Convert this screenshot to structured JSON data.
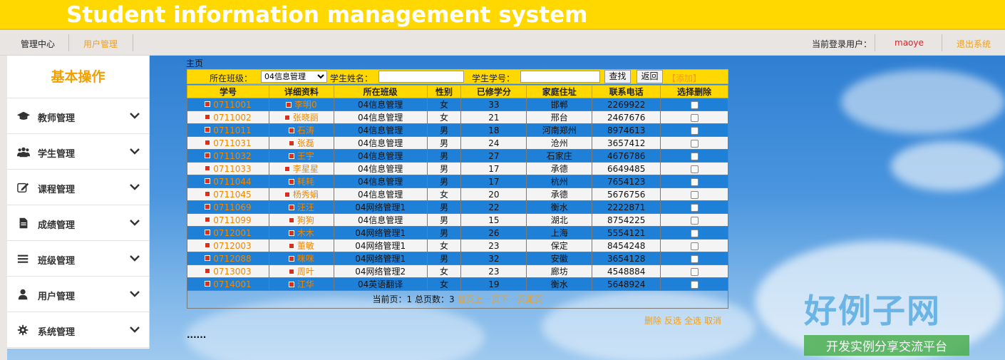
{
  "header": {
    "title": "Student information management system"
  },
  "nav": {
    "home": "管理中心",
    "user_mgmt": "用户管理",
    "current_user_label": "当前登录用户：",
    "current_user": "maoye",
    "logout": "退出系统"
  },
  "sidebar": {
    "title": "基本操作",
    "items": [
      {
        "label": "教师管理",
        "icon": "graduation-cap-icon"
      },
      {
        "label": "学生管理",
        "icon": "users-icon"
      },
      {
        "label": "课程管理",
        "icon": "edit-icon"
      },
      {
        "label": "成绩管理",
        "icon": "document-icon"
      },
      {
        "label": "班级管理",
        "icon": "list-icon"
      },
      {
        "label": "用户管理",
        "icon": "user-icon"
      },
      {
        "label": "系统管理",
        "icon": "gear-icon"
      }
    ]
  },
  "main": {
    "breadcrumb": "主页",
    "search": {
      "class_label": "所在班级：",
      "class_value": "04信息管理",
      "name_label": "学生姓名：",
      "name_value": "",
      "id_label": "学生学号：",
      "id_value": "",
      "find_button": "查找",
      "back_button": "返回",
      "add_link": "【添加】"
    },
    "table": {
      "headers": [
        "学号",
        "详细资料",
        "所在班级",
        "性别",
        "已修学分",
        "家庭住址",
        "联系电话",
        "选择删除"
      ],
      "rows": [
        {
          "id": "0711001",
          "name": "李明0",
          "class": "04信息管理",
          "gender": "女",
          "credits": "33",
          "address": "邯郸",
          "phone": "2269922"
        },
        {
          "id": "0711002",
          "name": "张晓丽",
          "class": "04信息管理",
          "gender": "女",
          "credits": "21",
          "address": "邢台",
          "phone": "2467676"
        },
        {
          "id": "0711011",
          "name": "石涛",
          "class": "04信息管理",
          "gender": "男",
          "credits": "18",
          "address": "河南郑州",
          "phone": "8974613"
        },
        {
          "id": "0711031",
          "name": "张磊",
          "class": "04信息管理",
          "gender": "男",
          "credits": "24",
          "address": "沧州",
          "phone": "3657412"
        },
        {
          "id": "0711032",
          "name": "王宇",
          "class": "04信息管理",
          "gender": "男",
          "credits": "27",
          "address": "石家庄",
          "phone": "4676786"
        },
        {
          "id": "0711033",
          "name": "李星星",
          "class": "04信息管理",
          "gender": "男",
          "credits": "17",
          "address": "承德",
          "phone": "6649485"
        },
        {
          "id": "0711044",
          "name": "耗耗",
          "class": "04信息管理",
          "gender": "男",
          "credits": "17",
          "address": "杭州",
          "phone": "7654123"
        },
        {
          "id": "0711045",
          "name": "杨秀娟",
          "class": "04信息管理",
          "gender": "女",
          "credits": "20",
          "address": "承德",
          "phone": "5676756"
        },
        {
          "id": "0711069",
          "name": "汪汪",
          "class": "04网络管理1",
          "gender": "男",
          "credits": "22",
          "address": "衡水",
          "phone": "2222871"
        },
        {
          "id": "0711099",
          "name": "狗狗",
          "class": "04信息管理",
          "gender": "男",
          "credits": "15",
          "address": "湖北",
          "phone": "8754225"
        },
        {
          "id": "0712001",
          "name": "木木",
          "class": "04网络管理1",
          "gender": "男",
          "credits": "26",
          "address": "上海",
          "phone": "5554121"
        },
        {
          "id": "0712003",
          "name": "董敏",
          "class": "04网络管理1",
          "gender": "女",
          "credits": "23",
          "address": "保定",
          "phone": "8454248"
        },
        {
          "id": "0712088",
          "name": "咪咪",
          "class": "04网络管理1",
          "gender": "男",
          "credits": "32",
          "address": "安徽",
          "phone": "3654128"
        },
        {
          "id": "0713003",
          "name": "周叶",
          "class": "04网络管理2",
          "gender": "女",
          "credits": "23",
          "address": "廊坊",
          "phone": "4548884"
        },
        {
          "id": "0714001",
          "name": "江华",
          "class": "04英语翻译",
          "gender": "女",
          "credits": "19",
          "address": "衡水",
          "phone": "5648924"
        }
      ]
    },
    "pager": {
      "text": "当前页：1 总页数：3 ",
      "first": "首页",
      "prev": "上一页",
      "next": "下一页",
      "last": "尾页"
    },
    "actions": {
      "delete": "删除",
      "invert": "反选",
      "select_all": "全选",
      "cancel": "取消"
    },
    "footer_dots": "......"
  },
  "watermark": {
    "brand": "好例子网",
    "slogan": "开发实例分享交流平台"
  },
  "colors": {
    "accent": "#ffd800",
    "row_blue": "#1f80d8",
    "link": "#f08800"
  }
}
